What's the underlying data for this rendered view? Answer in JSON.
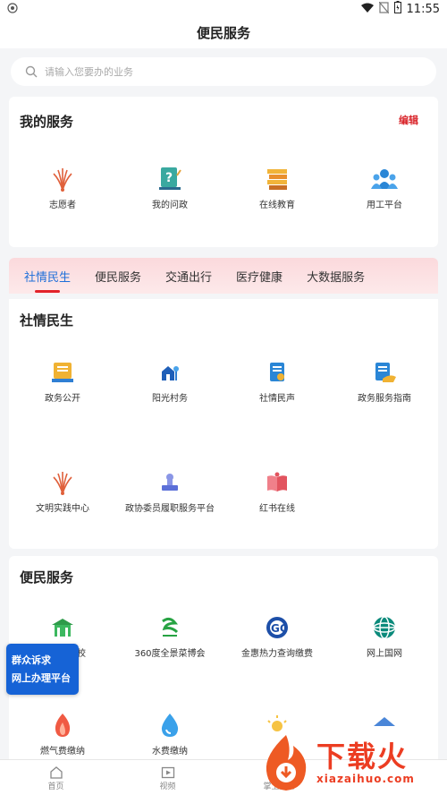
{
  "statusbar": {
    "time": "11:55"
  },
  "header": {
    "title": "便民服务"
  },
  "search": {
    "placeholder": "请输入您要办的业务"
  },
  "my_services": {
    "title": "我的服务",
    "edit_label": "编辑",
    "items": [
      {
        "label": "志愿者",
        "icon": "volunteer-icon"
      },
      {
        "label": "我的问政",
        "icon": "question-icon"
      },
      {
        "label": "在线教育",
        "icon": "education-icon"
      },
      {
        "label": "用工平台",
        "icon": "employment-icon"
      }
    ]
  },
  "tabs": [
    {
      "label": "社情民生",
      "active": true
    },
    {
      "label": "便民服务",
      "active": false
    },
    {
      "label": "交通出行",
      "active": false
    },
    {
      "label": "医疗健康",
      "active": false
    },
    {
      "label": "大数据服务",
      "active": false
    }
  ],
  "social": {
    "title": "社情民生",
    "items": [
      {
        "label": "政务公开"
      },
      {
        "label": "阳光村务"
      },
      {
        "label": "社情民声"
      },
      {
        "label": "政务服务指南"
      },
      {
        "label": "文明实践中心"
      },
      {
        "label": "政协委员履职服务平台"
      },
      {
        "label": "红书在线"
      }
    ]
  },
  "convenience": {
    "title": "便民服务",
    "items": [
      {
        "label": "校"
      },
      {
        "label": "360度全景菜博会"
      },
      {
        "label": "金惠热力查询缴费"
      },
      {
        "label": "网上国网"
      },
      {
        "label": "燃气费缴纳"
      },
      {
        "label": "水费缴纳"
      }
    ]
  },
  "float_badge": {
    "line1": "群众诉求",
    "line2": "网上办理平台"
  },
  "bottom_nav": [
    {
      "label": "首页"
    },
    {
      "label": "视频"
    },
    {
      "label": "掌上服务"
    },
    {
      "label": ""
    }
  ],
  "watermark": {
    "cn": "下载火",
    "en": "xiazaihuo.com"
  },
  "colors": {
    "accent_red": "#e2232a",
    "active_blue": "#1e6fd9",
    "badge_blue": "#1663d6"
  }
}
